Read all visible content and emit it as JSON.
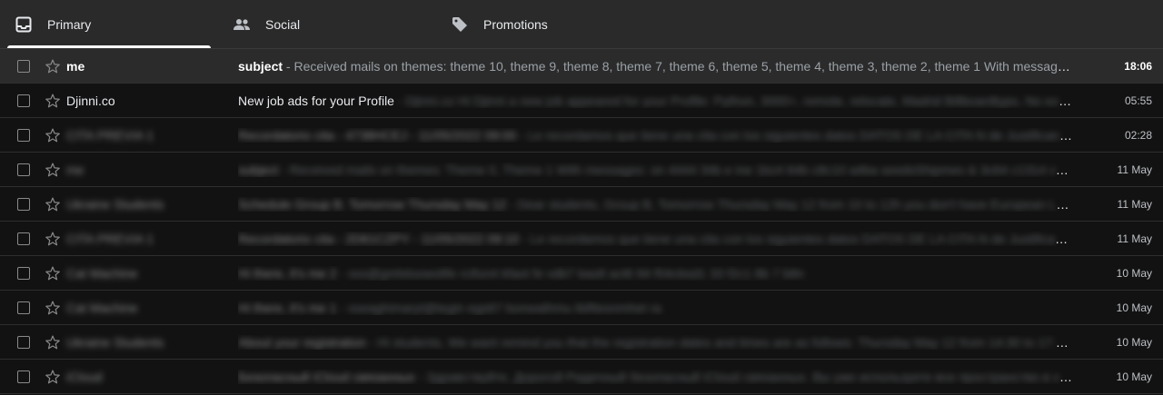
{
  "tabs": [
    {
      "label": "Primary",
      "icon": "inbox-icon",
      "active": true
    },
    {
      "label": "Social",
      "icon": "people-icon",
      "active": false
    },
    {
      "label": "Promotions",
      "icon": "tag-icon",
      "active": false
    }
  ],
  "emails": [
    {
      "sender": "me",
      "subject": "subject",
      "snippet": " - Received mails on themes: theme 10, theme 9, theme 8, theme 7, theme 6, theme 5, theme 4, theme 3, theme 2, theme 1 With messages: so...",
      "date": "18:06"
    },
    {
      "sender": "Djinni.co",
      "subject": "New job ads for your Profile",
      "snippet": " - Djinni.co Hi Djinni a new job appeared for your Profile: Python, 3000+, remote, relocate, Madrid Billboardtypo, No experien...",
      "date": "05:55"
    },
    {
      "sender": "CITA PREVIA 1",
      "subject": "Recordatorio cita - 4738HCEJ - 11/05/2022 09:00",
      "snippet": " - Le recordamos que tiene una cita con los siguientes datos DATOS DE LA CITA N de Justificante d...",
      "date": "02:28"
    },
    {
      "sender": "me",
      "subject": "subject",
      "snippet": " - Received mails on themes: Theme 0, Theme 1 With messages: on 4444 34b e ine 1bz4 64b c8c10 a4ba seedsShipmes & 3c64 c1314 vem...",
      "date": "11 May"
    },
    {
      "sender": "Ukraine Students",
      "subject": "Schedule Group B. Tomorrow Thursday May 12",
      "snippet": " - Dear students, Group B, Tomorrow Thursday May 12 from 10 to 12h you don't have European Law an...",
      "date": "11 May"
    },
    {
      "sender": "CITA PREVIA 1",
      "subject": "Recordatorio cita - 2D61CZPY - 11/05/2022 09:10",
      "snippet": " - Le recordamos que tiene una cita con los siguientes datos DATOS DE LA CITA N de Justificante de...",
      "date": "11 May"
    },
    {
      "sender": "Cat Machine",
      "subject": "Hi there, it's me 2",
      "snippet": " - sss@gmlsloowolife rcifun4 kfaot fe vdb7 bas8 act6 84 f04cbsd1 33 f2c1 8b 7 b8n",
      "date": "10 May"
    },
    {
      "sender": "Cat Machine",
      "subject": "Hi there, it's me 1",
      "snippet": " - sseaghimaryt@tegin egs67 bonwathmu ibifitesnmhet ra",
      "date": "10 May"
    },
    {
      "sender": "Ukraine Students",
      "subject": "About your registration",
      "snippet": " - Hi students, We want remind you that the registration dates and times are as follows: Thursday May 12 from 14:30 to 17:000...",
      "date": "10 May"
    },
    {
      "sender": "iCloud",
      "subject": "Безопасный iCloud связанных",
      "snippet": " - Здравствуйте, Дорогой Ридичный безопасный iCloud связанных. Вы уже используете все пространство в храни...",
      "date": "10 May"
    }
  ],
  "colors": {
    "background": "#121212",
    "tab_bar": "#2a2a2a",
    "first_row": "#2b2b2b",
    "text": "#e8eaed",
    "snippet": "#9aa0a6"
  }
}
